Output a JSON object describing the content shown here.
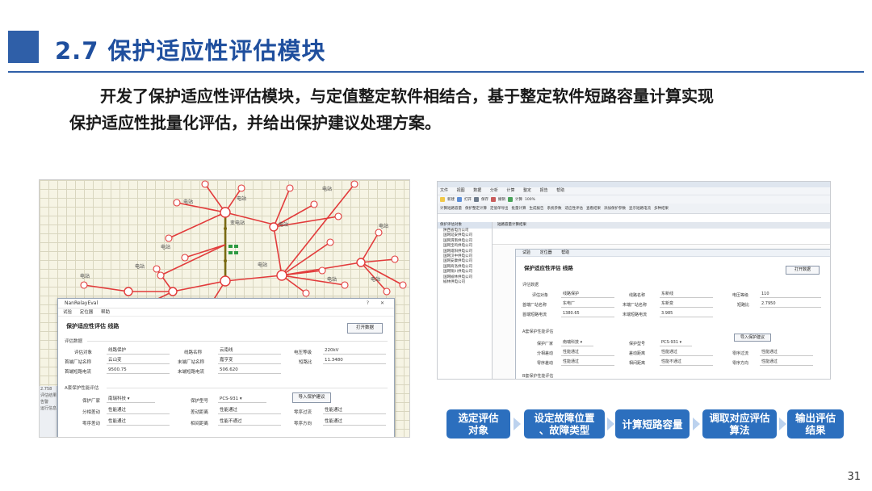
{
  "header": {
    "title": "2.7 保护适应性评估模块"
  },
  "intro": {
    "line1": "开发了保护适应性评估模块，与定值整定软件相结合，基于整定软件短路容量计算实现",
    "line2": "保护适应性批量化评估，并给出保护建议处理方案。"
  },
  "left_shot": {
    "node_labels": [
      "电站",
      "电站",
      "电站",
      "变电站",
      "电站",
      "电站",
      "电站",
      "电站",
      "电站",
      "电站",
      "电站",
      "电站"
    ],
    "dialog": {
      "window_title": "NanRelayEval",
      "window_controls": "? ✕",
      "menu": [
        "试验",
        "定位器",
        "帮助"
      ],
      "heading": "保护适应性评估 线路",
      "open_button": "打开数据",
      "section1": "评估数据",
      "fields1": [
        {
          "label": "评估对象",
          "value": "线路保护"
        },
        {
          "label": "线路名称",
          "value": "云南线"
        },
        {
          "label": "电压等级",
          "value": "220kV"
        },
        {
          "label": "首端厂站名称",
          "value": "云山变"
        },
        {
          "label": "末端厂站名称",
          "value": "嘉亨变"
        },
        {
          "label": "短路比",
          "value": "11.3480"
        },
        {
          "label": "首端短路电流",
          "value": "9500.75"
        },
        {
          "label": "末端短路电流",
          "value": "506.620"
        }
      ],
      "section2": "A套保护性能评估",
      "fields2": [
        {
          "label": "保护厂家",
          "value": "南瑞科技"
        },
        {
          "label": "保护型号",
          "value": "PCS-931"
        },
        {
          "label": "分相差动",
          "value": "性能通过"
        },
        {
          "label": "差动距离",
          "value": "性能通过"
        },
        {
          "label": "零序过流",
          "value": "性能通过"
        },
        {
          "label": "零序差动",
          "value": "性能通过"
        },
        {
          "label": "相间距离",
          "value": "性能不通过"
        },
        {
          "label": "零序方向",
          "value": "性能通过"
        }
      ],
      "import_button": "导入保护建议"
    },
    "side_strip": [
      "2.758",
      "评估结果",
      "告警",
      "运行信息"
    ]
  },
  "right_shot": {
    "menu": [
      "文件",
      "视图",
      "数据",
      "分析",
      "计算",
      "整定",
      "报告",
      "帮助"
    ],
    "toolbar1": [
      "新建",
      "打开",
      "保存",
      "撤销",
      "计算",
      "100%"
    ],
    "toolbar2": [
      "计算短路容量",
      "保护整定计算",
      "定值单导出",
      "批量计算",
      "生成报告",
      "系统参数",
      "适应性评估",
      "查看结果",
      "添加保护参数",
      "显示短路电流",
      "多种结果"
    ],
    "tree_header": "保护评估对象",
    "tree_items": [
      "陕西省电力公司",
      "国网延安供电公司",
      "国网渭南供电公司",
      "国网宝鸡供电公司",
      "国网咸阳供电公司",
      "国网汉中供电公司",
      "国网安康供电公司",
      "国网商洛供电公司",
      "国网铜川供电公司",
      "国网榆林供电公司",
      "榆林供电公司"
    ],
    "doc_tab": "短路容量计算结果",
    "dialog": {
      "menu": [
        "试验",
        "定位器",
        "帮助"
      ],
      "heading": "保护适应性评估 线路",
      "open_button": "打开数据",
      "section1": "评估数据",
      "fields1": [
        {
          "label": "评估对象",
          "value": "线路保护"
        },
        {
          "label": "线路名称",
          "value": "东新线"
        },
        {
          "label": "电压等级",
          "value": "110"
        },
        {
          "label": "首端厂站名称",
          "value": "东电厂"
        },
        {
          "label": "末端厂站名称",
          "value": "东新变"
        },
        {
          "label": "短路比",
          "value": "2.7950"
        },
        {
          "label": "首端短路电流",
          "value": "1380.65"
        },
        {
          "label": "末端短路电流",
          "value": "3.985"
        }
      ],
      "section2": "A套保护性能评估",
      "fields2": [
        {
          "label": "保护厂家",
          "value": "南瑞科技"
        },
        {
          "label": "保护型号",
          "value": "PCS-931"
        },
        {
          "label": "分相差动",
          "value": "性能通过"
        },
        {
          "label": "差动距离",
          "value": "性能通过"
        },
        {
          "label": "零序过流",
          "value": "性能通过"
        },
        {
          "label": "零序差动",
          "value": "性能通过"
        },
        {
          "label": "相间距离",
          "value": "性能不通过"
        },
        {
          "label": "零序方向",
          "value": "性能通过"
        }
      ],
      "import_button": "导入保护建议",
      "section3": "B套保护性能评估"
    }
  },
  "flow": {
    "steps": [
      "选定评估\n对象",
      "设定故障位置\n、故障类型",
      "计算短路容量",
      "调取对应评估\n算法",
      "输出评估\n结果"
    ]
  },
  "page_number": "31",
  "colors": {
    "accent": "#2f5fa8",
    "title": "#1f4f9e",
    "step_fill": "#2c6fbe",
    "arrow": "#bcd2ee",
    "net_line": "#e23b3b",
    "bus_line": "#7a6a12"
  }
}
